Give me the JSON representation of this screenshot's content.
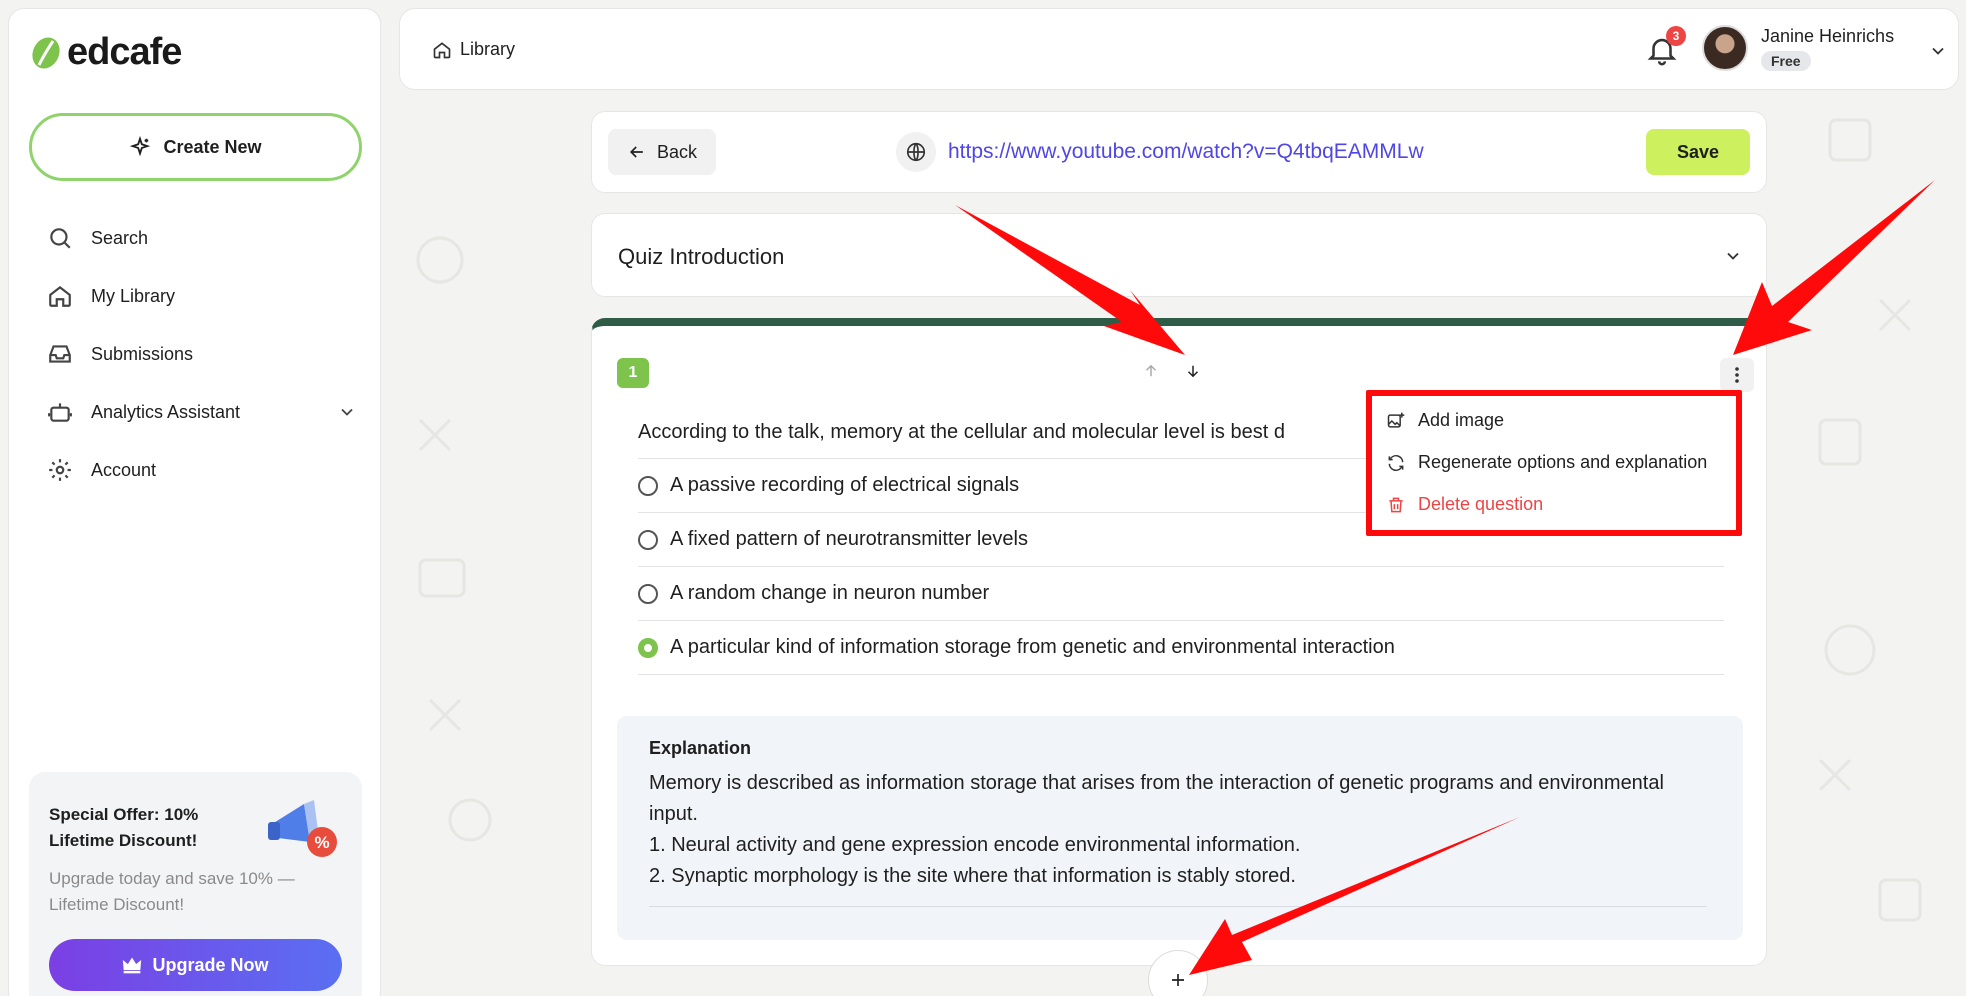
{
  "app": {
    "logo_text": "edcafe"
  },
  "sidebar": {
    "create_label": "Create New",
    "items": [
      {
        "label": "Search",
        "icon": "search-icon"
      },
      {
        "label": "My Library",
        "icon": "home-icon"
      },
      {
        "label": "Submissions",
        "icon": "inbox-icon"
      },
      {
        "label": "Analytics Assistant",
        "icon": "robot-icon"
      },
      {
        "label": "Account",
        "icon": "gear-icon"
      }
    ],
    "offer": {
      "title": "Special Offer: 10% Lifetime Discount!",
      "text": "Upgrade today and save 10% — Lifetime Discount!",
      "badge": "%",
      "button_label": "Upgrade Now"
    }
  },
  "header": {
    "breadcrumb": "Library",
    "notification_count": "3",
    "user_name": "Janine Heinrichs",
    "plan": "Free"
  },
  "toolbar": {
    "back_label": "Back",
    "url": "https://www.youtube.com/watch?v=Q4tbqEAMMLw",
    "save_label": "Save"
  },
  "intro": {
    "title": "Quiz Introduction"
  },
  "question": {
    "number": "1",
    "text": "According to the talk, memory at the cellular and molecular level is best d",
    "options": [
      {
        "label": "A passive recording of electrical signals",
        "selected": false
      },
      {
        "label": "A fixed pattern of neurotransmitter levels",
        "selected": false
      },
      {
        "label": "A random change in neuron number",
        "selected": false
      },
      {
        "label": "A particular kind of information storage from genetic and environmental interaction",
        "selected": true
      }
    ],
    "explanation_title": "Explanation",
    "explanation_lines": [
      "Memory is described as information storage that arises from the interaction of genetic programs and environmental input.",
      "1. Neural activity and gene expression encode environmental information.",
      "2. Synaptic morphology is the site where that information is stably stored."
    ]
  },
  "menu": {
    "items": [
      {
        "label": "Add image",
        "icon": "add-image-icon"
      },
      {
        "label": "Regenerate options and explanation",
        "icon": "refresh-icon"
      },
      {
        "label": "Delete question",
        "icon": "trash-icon"
      }
    ]
  },
  "colors": {
    "accent_green": "#7dc34c",
    "save_yellow": "#cdf05f",
    "card_top_border": "#2f5c46",
    "link_blue": "#4f46e5",
    "danger_red": "#ef4444",
    "annotation_red": "#ff0a0a",
    "upgrade_gradient_start": "#7b3fe4",
    "upgrade_gradient_end": "#5a6ff2"
  }
}
